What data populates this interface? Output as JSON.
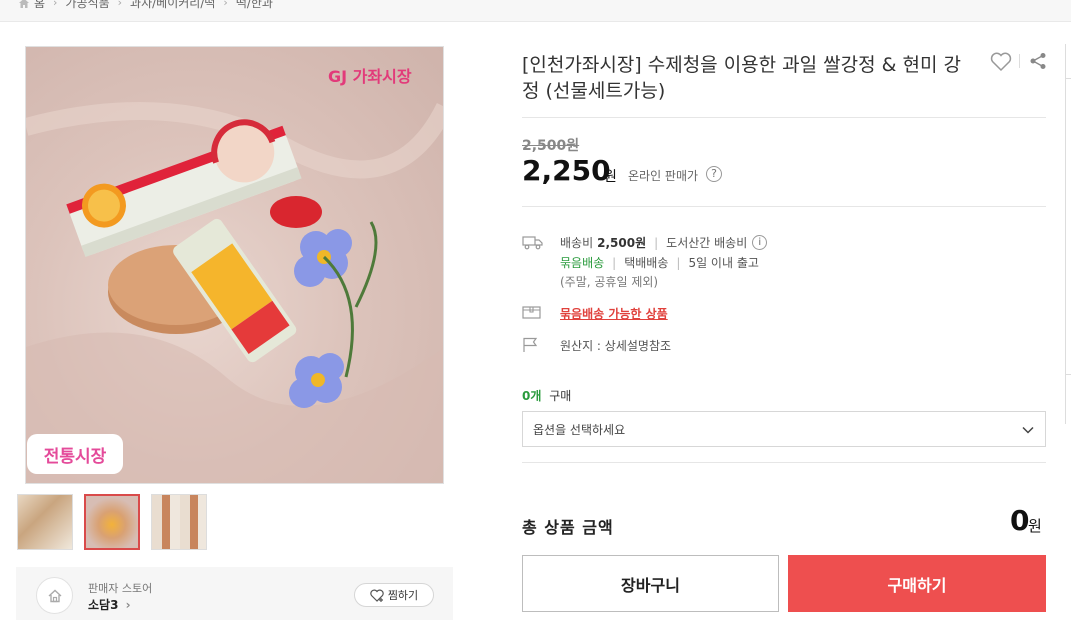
{
  "breadcrumb": {
    "home_label": "홈",
    "items": [
      "가공식품",
      "과자/베이커리/떡",
      "떡/한과"
    ]
  },
  "product": {
    "title": "[인천가좌시장] 수제청을 이용한 과일 쌀강정 & 현미 강정 (선물세트가능)",
    "image_logo_text": "GJ 가좌시장",
    "image_badge": "전통시장",
    "original_price": "2,500원",
    "sale_price": "2,250",
    "currency": "원",
    "price_type": "온라인 판매가",
    "help_glyph": "?"
  },
  "shipping": {
    "fee_label": "배송비",
    "fee_value": "2,500원",
    "remote_label": "도서산간 배송비",
    "info_glyph": "i",
    "bundle": "묶음배송",
    "method": "택배배송",
    "lead_time": "5일 이내 출고",
    "note": "(주말, 공휴일 제외)",
    "bundle_link": "묶음배송 가능한 상품",
    "origin": "원산지 : 상세설명참조"
  },
  "purchase": {
    "qty_count": "0개",
    "qty_suffix": "구매",
    "option_placeholder": "옵션을 선택하세요",
    "total_label": "총 상품 금액",
    "total_value": "0",
    "total_currency": "원",
    "cart_label": "장바구니",
    "buy_label": "구매하기"
  },
  "seller": {
    "label": "판매자 스토어",
    "name": "소담3",
    "fav_label": "찜하기"
  },
  "colors": {
    "accent_red": "#ee4f4f",
    "bundle_green": "#2a9b3d"
  }
}
